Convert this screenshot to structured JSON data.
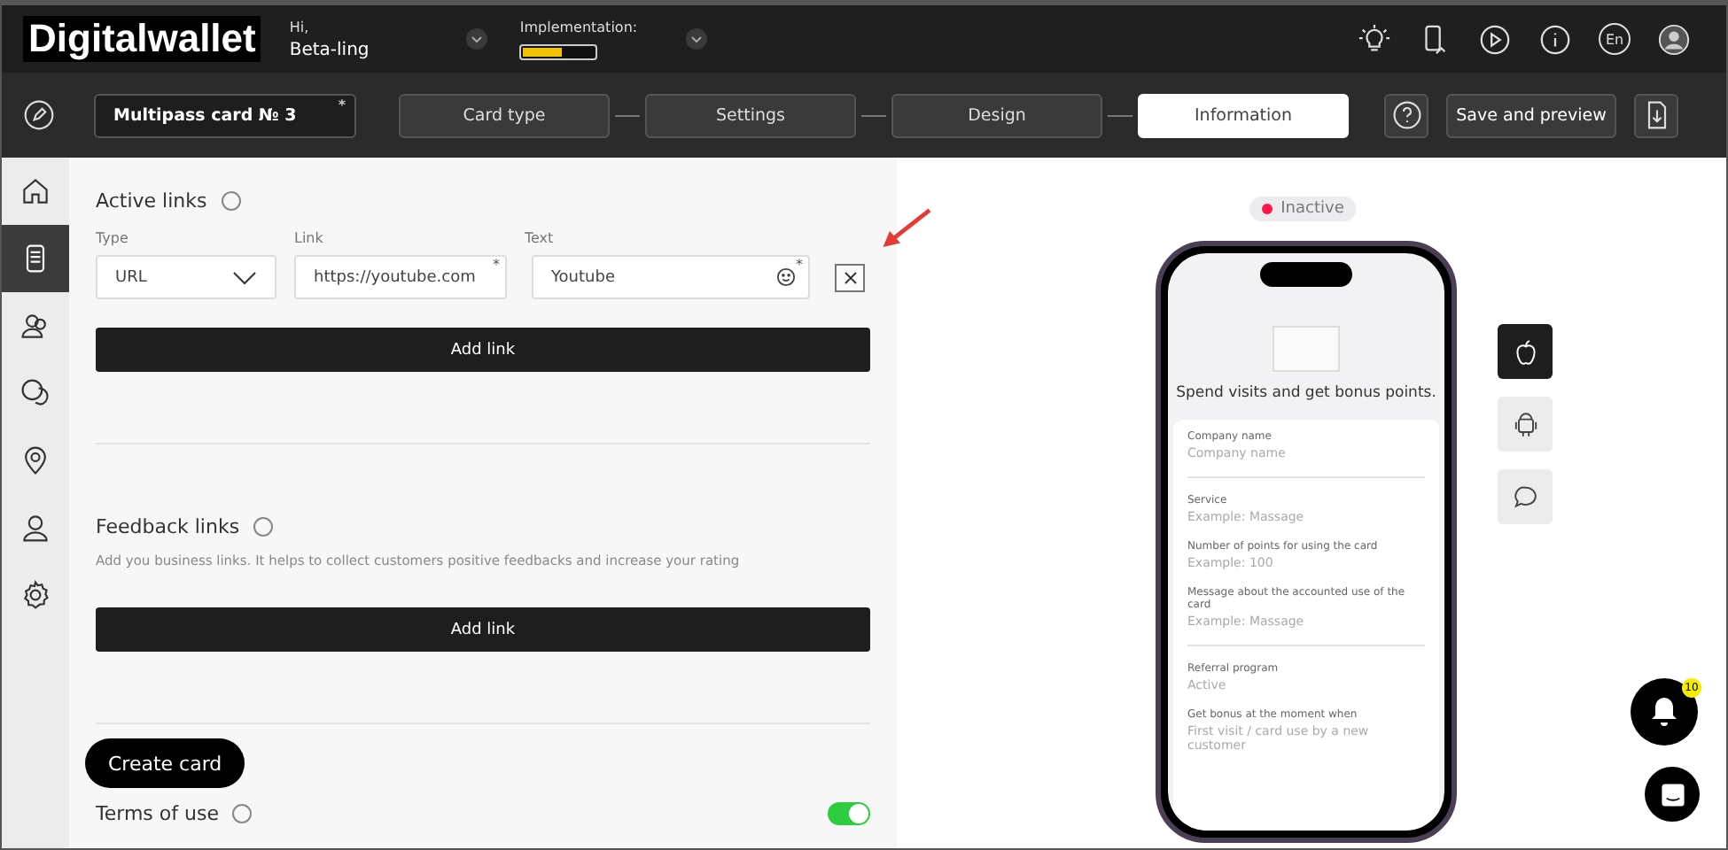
{
  "header": {
    "logo": "Digitalwallet",
    "greeting": "Hi,",
    "user": "Beta-ling",
    "implementation": {
      "label": "Implementation:",
      "level": 0.55
    },
    "icons": [
      {
        "kind": "bulb"
      },
      {
        "kind": "phone"
      },
      {
        "kind": "play"
      },
      {
        "kind": "info"
      },
      {
        "kind": "lang",
        "text": "En"
      },
      {
        "kind": "avatar"
      }
    ]
  },
  "toolbar": {
    "card_name": "Multipass card № 3",
    "required_mark": "*",
    "steps": [
      {
        "label": "Card type",
        "selected": false
      },
      {
        "label": "Settings",
        "selected": false
      },
      {
        "label": "Design",
        "selected": false
      },
      {
        "label": "Information",
        "selected": true
      }
    ],
    "save": "Save and preview"
  },
  "sidebar": {
    "items": [
      {
        "kind": "home",
        "selected": false
      },
      {
        "kind": "card",
        "selected": true
      },
      {
        "kind": "users",
        "selected": false
      },
      {
        "kind": "chat",
        "selected": false
      },
      {
        "kind": "location",
        "selected": false
      },
      {
        "kind": "person",
        "selected": false
      },
      {
        "kind": "settings",
        "selected": false
      }
    ]
  },
  "active_links": {
    "title": "Active links",
    "columns": [
      "Type",
      "Link",
      "Text"
    ],
    "type": "URL",
    "link": "https://youtube.com",
    "link_mark": "*",
    "text": "Youtube",
    "text_mark": "*",
    "add": "Add link"
  },
  "feedback_links": {
    "title": "Feedback links",
    "description": "Add you business links. It helps to collect customers positive feedbacks and increase your rating",
    "add": "Add link"
  },
  "terms": {
    "title": "Terms of use",
    "on": true
  },
  "create_card": "Create card",
  "preview": {
    "status": "Inactive",
    "active": false,
    "headline": "Spend visits and get bonus points.",
    "fields": [
      {
        "label": "Company name",
        "value": "Company name",
        "divider": true
      },
      {
        "label": "Service",
        "value": "Example: Massage",
        "divider": false
      },
      {
        "label": "Number of points for using the card",
        "value": "Example: 100",
        "divider": false
      },
      {
        "label": "Message about the accounted use of the card",
        "value": "Example: Massage",
        "divider": true
      },
      {
        "label": "Referral program",
        "value": "Active",
        "divider": false
      },
      {
        "label": "Get bonus at the moment when",
        "value": "First visit / card use by a new customer",
        "divider": false
      }
    ],
    "platforms": [
      {
        "kind": "apple",
        "selected": true
      },
      {
        "kind": "android",
        "selected": false
      },
      {
        "kind": "message",
        "selected": false
      }
    ],
    "notifications": "10"
  }
}
